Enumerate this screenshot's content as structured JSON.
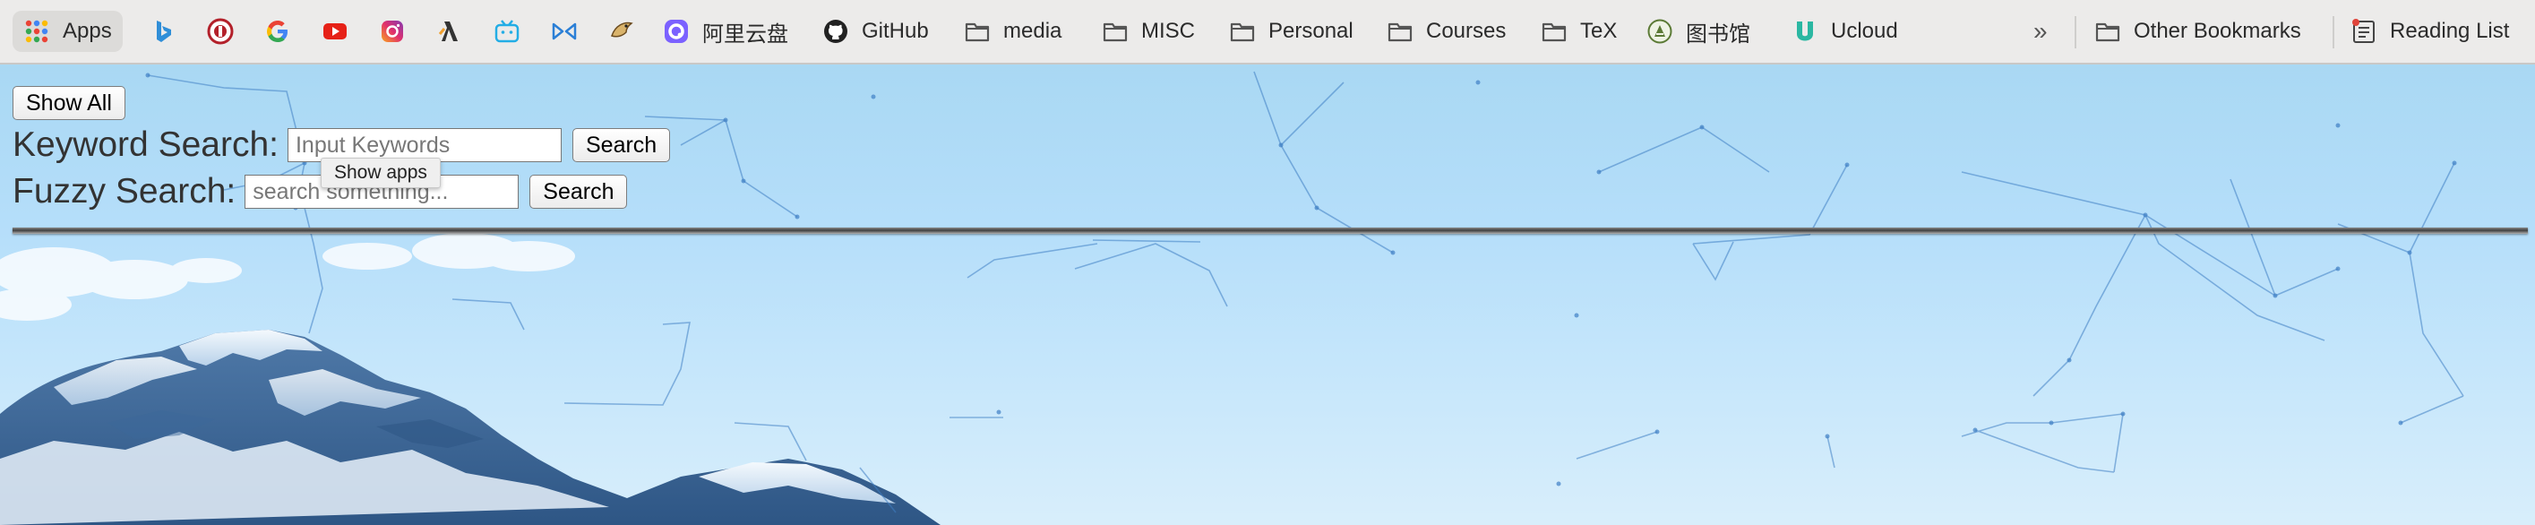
{
  "bookmarks": {
    "apps_label": "Apps",
    "items": [
      {
        "label": "阿里云盘",
        "icon": "aliyundrive-icon"
      },
      {
        "label": "GitHub",
        "icon": "github-icon"
      },
      {
        "label": "media",
        "icon": "folder-icon"
      },
      {
        "label": "MISC",
        "icon": "folder-icon"
      },
      {
        "label": "Personal",
        "icon": "folder-icon"
      },
      {
        "label": "Courses",
        "icon": "folder-icon"
      },
      {
        "label": "TeX",
        "icon": "folder-icon"
      },
      {
        "label": "图书馆",
        "icon": "library-icon"
      },
      {
        "label": "Ucloud",
        "icon": "ucloud-icon"
      }
    ],
    "overflow_label": "»",
    "other_bookmarks_label": "Other Bookmarks",
    "reading_list_label": "Reading List"
  },
  "page": {
    "show_all_label": "Show All",
    "keyword_search": {
      "label": "Keyword Search:",
      "placeholder": "Input Keywords",
      "button": "Search"
    },
    "fuzzy_search": {
      "label": "Fuzzy Search:",
      "placeholder": "search something...",
      "button": "Search"
    },
    "tooltip": "Show apps"
  },
  "colors": {
    "sky_top": "#a9d8f3",
    "bookmark_bar": "#ecebea",
    "network_lines": "#3f7fc4"
  }
}
